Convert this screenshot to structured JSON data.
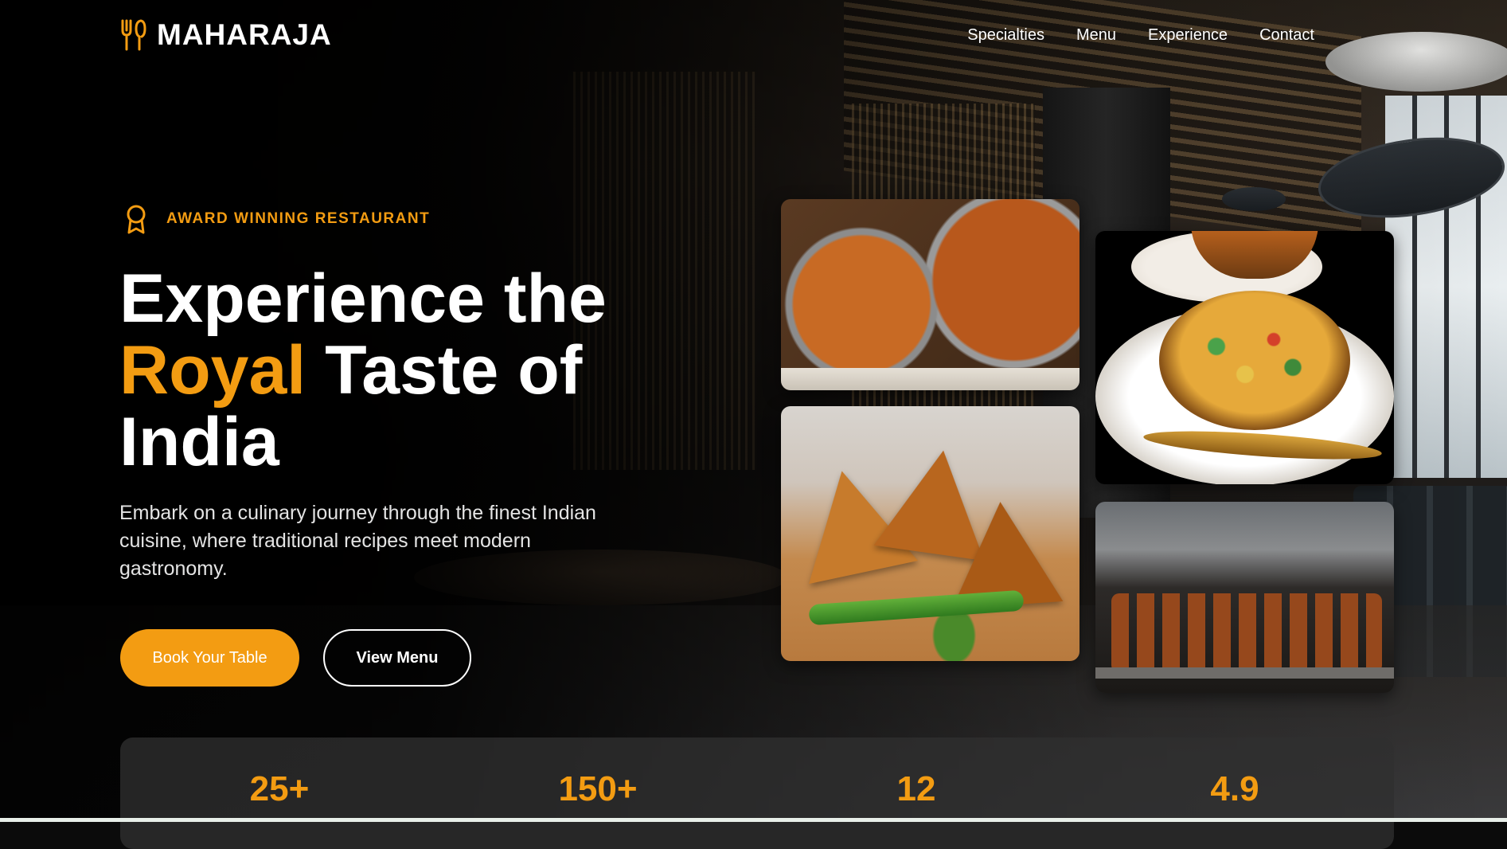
{
  "brand": {
    "name": "MAHARAJA",
    "icon": "fork-knife-icon"
  },
  "nav": {
    "links": [
      "Specialties",
      "Menu",
      "Experience",
      "Contact"
    ]
  },
  "hero": {
    "badge": {
      "icon": "award-icon",
      "text": "AWARD WINNING RESTAURANT"
    },
    "headline": {
      "line1": "Experience the",
      "accent": "Royal",
      "line2_rest": " Taste of",
      "line3": "India"
    },
    "subtext": "Embark on a culinary journey through the finest Indian cuisine, where traditional recipes meet modern gastronomy.",
    "buttons": {
      "primary": "Book Your Table",
      "secondary": "View Menu"
    }
  },
  "gallery": [
    "curry-photo",
    "biryani-photo",
    "samosa-photo",
    "kebab-photo"
  ],
  "stats": [
    {
      "value": "25+"
    },
    {
      "value": "150+"
    },
    {
      "value": "12"
    },
    {
      "value": "4.9"
    }
  ],
  "colors": {
    "accent": "#f39c12",
    "background": "#0b0b0b",
    "text": "#ffffff"
  }
}
